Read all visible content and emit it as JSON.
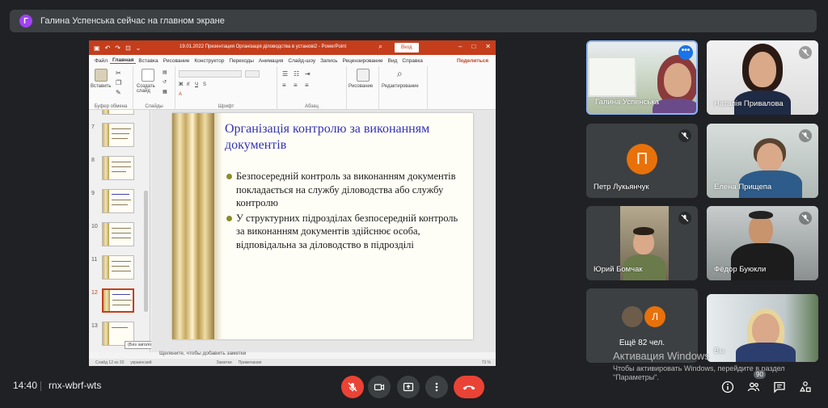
{
  "banner": {
    "avatar_letter": "Г",
    "text": "Галина Успенська сейчас на главном экране"
  },
  "powerpoint": {
    "window_title": "19.01.2022 Презентация Організація діловодства в установі2 - PowerPoint",
    "login_button": "Вход",
    "tabs": [
      "Файл",
      "Главная",
      "Вставка",
      "Рисование",
      "Конструктор",
      "Переходы",
      "Анимация",
      "Слайд-шоу",
      "Запись",
      "Рецензирование",
      "Вид",
      "Справка"
    ],
    "active_tab": "Главная",
    "share_label": "Поделиться",
    "ribbon": {
      "paste": "Вставить",
      "new_slide": "Создать слайд",
      "group_clipboard": "Буфер обмена",
      "group_slides": "Слайды",
      "group_font": "Шрифт",
      "group_paragraph": "Абзац",
      "drawing": "Рисование",
      "editing": "Редактирование"
    },
    "thumbnails": [
      {
        "num": "7"
      },
      {
        "num": "8"
      },
      {
        "num": "9"
      },
      {
        "num": "10"
      },
      {
        "num": "11"
      },
      {
        "num": "12"
      },
      {
        "num": "13"
      }
    ],
    "current_slide": "12",
    "tooltip": "(Без заголовка)",
    "slide": {
      "title": "Організація контролю за виконанням документів",
      "bullets": [
        "Безпосередній контроль за виконанням документів покладається на службу діловодства або службу контролю",
        "У структурних підрозділах безпосередній контроль за виконанням документів здійснює особа, відповідальна за діловодство в підрозділі"
      ]
    },
    "notes_placeholder": "Щелкните, чтобы добавить заметки",
    "status": {
      "slide_info": "Слайд 12 из 20",
      "language": "украинский",
      "notes": "Заметки",
      "comments": "Примечания",
      "zoom": "73 %"
    }
  },
  "participants": [
    {
      "name": "Галина Успенська",
      "muted": false,
      "active_speaker": true
    },
    {
      "name": "Наталія Привалова",
      "muted": true
    },
    {
      "name": "Петр Лукьянчук",
      "muted": true,
      "avatar_letter": "П"
    },
    {
      "name": "Елена Прищепа",
      "muted": true
    },
    {
      "name": "Юрий Бомчак",
      "muted": true
    },
    {
      "name": "Фёдор Буюкли",
      "muted": true
    },
    {
      "name": "Вы",
      "muted": false
    }
  ],
  "more_tile": {
    "text": "Ещё 82 чел.",
    "mini_letter": "Л"
  },
  "activation": {
    "heading": "Активация Windows",
    "subtext": "Чтобы активировать Windows, перейдите в раздел \"Параметры\"."
  },
  "bottom": {
    "time": "14:40",
    "meeting_code": "rnx-wbrf-wts",
    "people_count": "90"
  },
  "colors": {
    "ppt_red": "#c43e1c",
    "meet_bg": "#202124",
    "tile_bg": "#3c4043",
    "hangup_red": "#ea4335",
    "slide_title_blue": "#3232b8"
  }
}
